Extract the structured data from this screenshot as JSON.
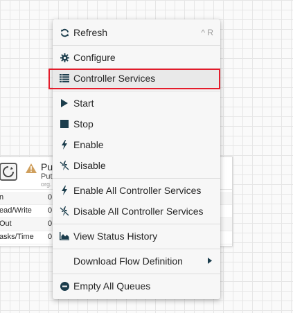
{
  "processor": {
    "name": "Pu",
    "type": "Put",
    "bundle": "org.",
    "stats": [
      {
        "label": "n",
        "value": "0"
      },
      {
        "label": "ead/Write",
        "value": "0"
      },
      {
        "label": "Out",
        "value": "0"
      },
      {
        "label": "asks/Time",
        "value": "0"
      }
    ]
  },
  "menu": {
    "refresh": {
      "label": "Refresh",
      "shortcut": "^ R",
      "icon": "refresh-icon"
    },
    "configure": {
      "label": "Configure",
      "icon": "gear-icon"
    },
    "controller_services": {
      "label": "Controller Services",
      "icon": "list-icon"
    },
    "start": {
      "label": "Start",
      "icon": "play-icon"
    },
    "stop": {
      "label": "Stop",
      "icon": "stop-icon"
    },
    "enable": {
      "label": "Enable",
      "icon": "bolt-icon"
    },
    "disable": {
      "label": "Disable",
      "icon": "disabled-bolt-icon"
    },
    "enable_all": {
      "label": "Enable All Controller Services",
      "icon": "bolt-icon"
    },
    "disable_all": {
      "label": "Disable All Controller Services",
      "icon": "disabled-bolt-icon"
    },
    "status_history": {
      "label": "View Status History",
      "icon": "area-chart-icon"
    },
    "download_flow": {
      "label": "Download Flow Definition",
      "icon": "submenu-arrow-icon"
    },
    "empty_queues": {
      "label": "Empty All Queues",
      "icon": "minus-circle-icon"
    }
  },
  "colors": {
    "icon": "#1b3d4c",
    "highlight_border": "#e41c2b",
    "warning": "#cf9f5d"
  }
}
